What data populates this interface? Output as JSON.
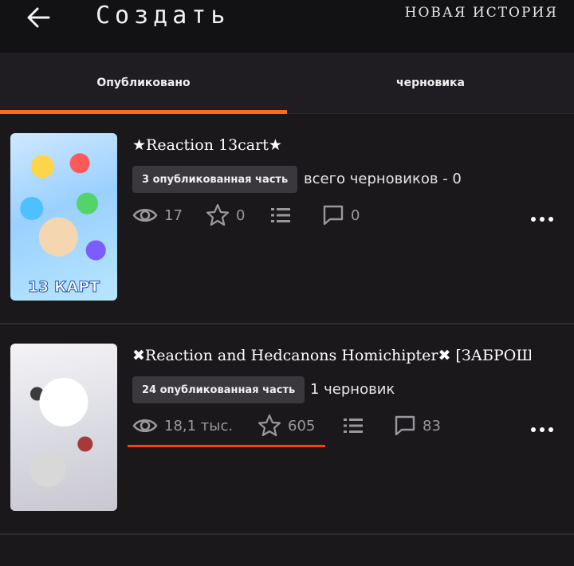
{
  "header": {
    "title": "Создать",
    "new_story": "НОВАЯ ИСТОРИЯ"
  },
  "tabs": [
    {
      "label": "Опубликовано",
      "active": true
    },
    {
      "label": "черновика",
      "active": false
    }
  ],
  "stories": [
    {
      "title": "★Reaction 13cart★",
      "cover_text": "13 КАРТ",
      "published_badge": "3 опубликованная часть",
      "drafts_text": "всего черновиков - 0",
      "views": "17",
      "votes": "0",
      "comments": "0"
    },
    {
      "title": "✖Reaction and Hedcanons Homichipter✖ [ЗАБРОШ...",
      "published_badge": "24 опубликованная часть",
      "drafts_text": "1 черновик",
      "views": "18,1 тыс.",
      "votes": "605",
      "comments": "83"
    }
  ],
  "colors": {
    "accent_orange": "#ff6a1a",
    "highlight_red": "#ff3b1a",
    "background": "#1b181c"
  },
  "icons": [
    "back-arrow-icon",
    "eye-icon",
    "star-icon",
    "list-icon",
    "comment-icon",
    "more-icon"
  ]
}
